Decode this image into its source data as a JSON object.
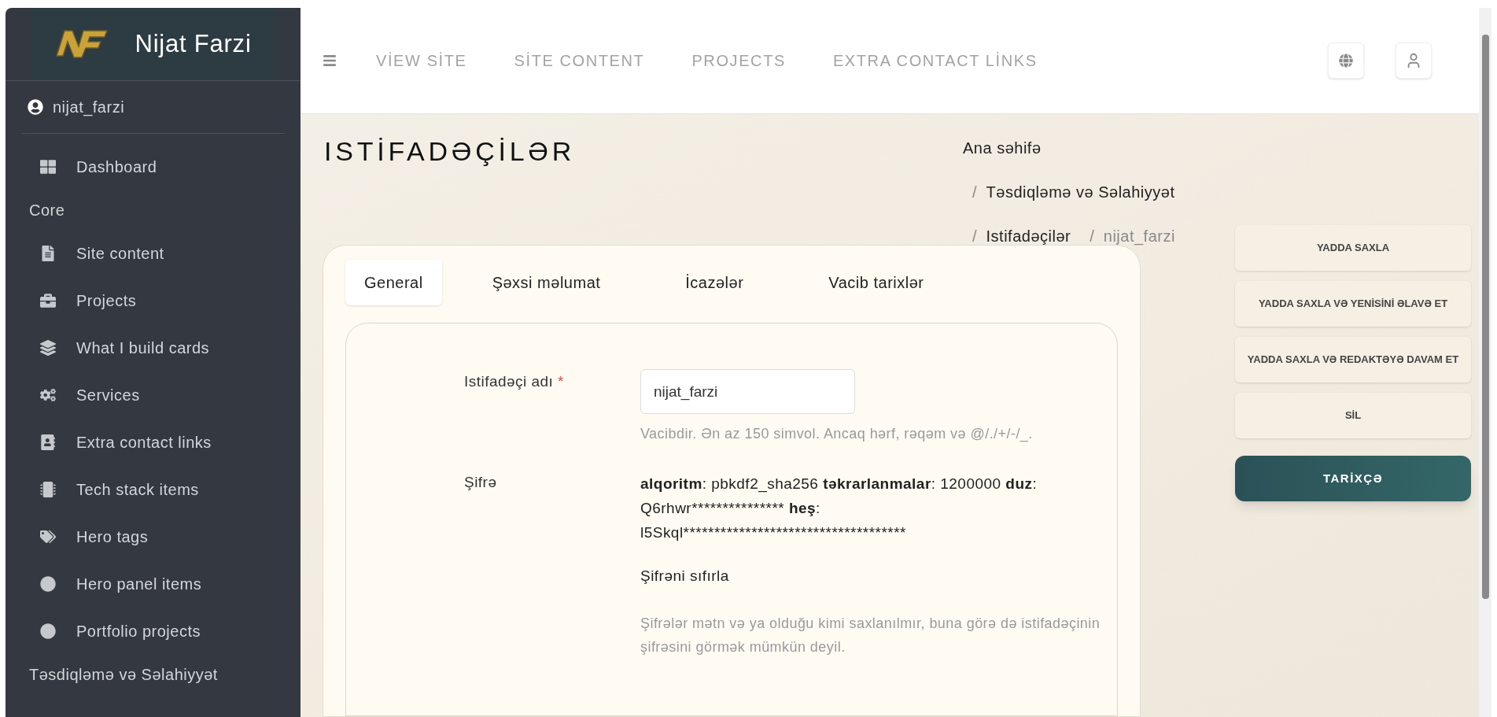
{
  "sidebar": {
    "brand": "Nijat Farzi",
    "user": "nijat_farzi",
    "items": [
      {
        "kind": "item",
        "label": "Dashboard"
      },
      {
        "kind": "heading",
        "label": "Core"
      },
      {
        "kind": "item",
        "label": "Site content"
      },
      {
        "kind": "item",
        "label": "Projects"
      },
      {
        "kind": "item",
        "label": "What I build cards"
      },
      {
        "kind": "item",
        "label": "Services"
      },
      {
        "kind": "item",
        "label": "Extra contact links"
      },
      {
        "kind": "item",
        "label": "Tech stack items"
      },
      {
        "kind": "item",
        "label": "Hero tags"
      },
      {
        "kind": "item",
        "label": "Hero panel items"
      },
      {
        "kind": "item",
        "label": "Portfolio projects"
      },
      {
        "kind": "heading",
        "label": "Təsdiqləmə və Səlahiyyət"
      }
    ]
  },
  "navbar": {
    "links": [
      "VİEW SİTE",
      "SİTE CONTENT",
      "PROJECTS",
      "EXTRA CONTACT LİNKS"
    ]
  },
  "page": {
    "title": "ISTİFADƏÇİLƏR",
    "breadcrumb": {
      "separator": "/",
      "items": [
        "Ana səhifə",
        "Təsdiqləmə və Səlahiyyət",
        "Istifadəçilər",
        "nijat_farzi"
      ]
    }
  },
  "tabs": [
    {
      "label": "General",
      "selected": true
    },
    {
      "label": "Şəxsi məlumat",
      "selected": false
    },
    {
      "label": "İcazələr",
      "selected": false
    },
    {
      "label": "Vacib tarixlər",
      "selected": false
    }
  ],
  "form": {
    "username": {
      "label": "Istifadəçi adı",
      "required_mark": "*",
      "value": "nijat_farzi",
      "help": "Vacibdir. Ən az 150 simvol. Ancaq hərf, rəqəm və @/./+/-/_."
    },
    "password": {
      "label": "Şifrə",
      "info": [
        {
          "text": "alqoritm",
          "bold": true
        },
        {
          "text": ": pbkdf2_sha256 ",
          "bold": false
        },
        {
          "text": "təkrarlanmalar",
          "bold": true
        },
        {
          "text": ": 1200000 ",
          "bold": false
        },
        {
          "text": "duz",
          "bold": true
        },
        {
          "text": ": Q6rhwr*************** ",
          "bold": false
        },
        {
          "text": "heş",
          "bold": true
        },
        {
          "text": ": l5Skql************************************",
          "bold": false
        }
      ],
      "reset": "Şifrəni sıfırla",
      "help": "Şifrələr mətn və ya olduğu kimi saxlanılmır, buna görə də istifadəçinin şifrəsini görmək mümkün deyil."
    }
  },
  "actions": [
    {
      "kind": "plain",
      "label": "YADDA SAXLA"
    },
    {
      "kind": "plain",
      "label": "YADDA SAXLA VƏ YENİSİNİ ƏLAVƏ ET"
    },
    {
      "kind": "plain",
      "label": "YADDA SAXLA VƏ REDAKTƏYƏ DAVAM ET"
    },
    {
      "kind": "plain",
      "label": "SİL"
    },
    {
      "kind": "primary",
      "label": "TARİXÇƏ"
    }
  ]
}
